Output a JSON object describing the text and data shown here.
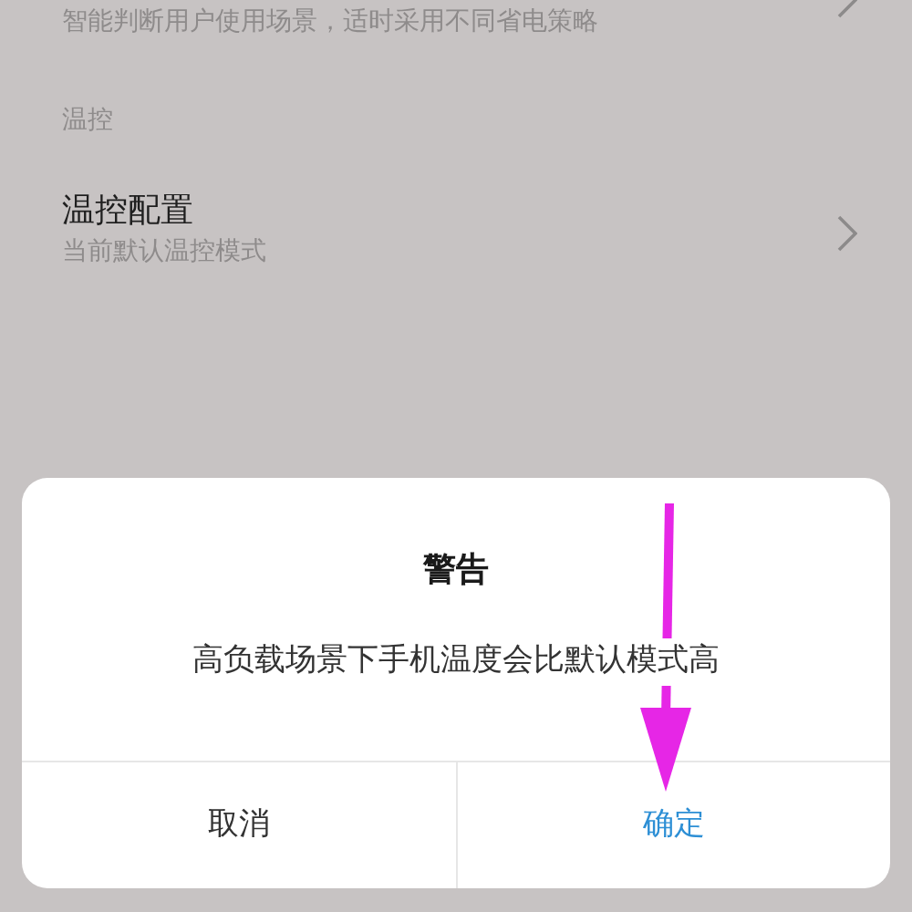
{
  "settings": [
    {
      "kind": "row_partial",
      "subtitle": "智能判断用户使用场景，适时采用不同省电策略"
    },
    {
      "kind": "section",
      "label": "温控"
    },
    {
      "kind": "row",
      "title": "温控配置",
      "subtitle": "当前默认温控模式"
    }
  ],
  "dialog": {
    "title": "警告",
    "message": "高负载场景下手机温度会比默认模式高",
    "buttons": [
      {
        "label": "取消",
        "primary": false
      },
      {
        "label": "确定",
        "primary": true
      }
    ]
  }
}
